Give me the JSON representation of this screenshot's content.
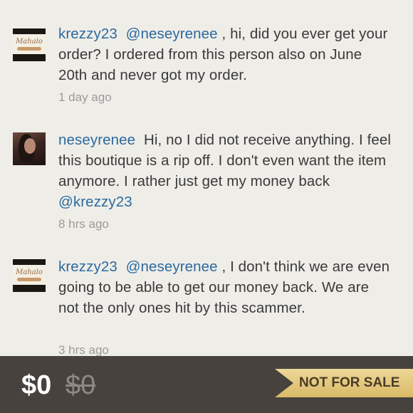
{
  "comments": [
    {
      "username": "krezzy23",
      "mention": "@neseyrenee",
      "text": ", hi, did you ever get your order? I ordered from this person also on June 20th and never got my order.",
      "time": "1 day ago",
      "avatar_text": "Mahalo"
    },
    {
      "username": "neseyrenee",
      "text": "Hi, no I did not receive anything. I feel this boutique is a rip off. I don't even want the item anymore. I rather just get my money back",
      "mention": "@krezzy23",
      "time": "8 hrs ago"
    },
    {
      "username": "krezzy23",
      "mention": "@neseyrenee",
      "text": ", I don't think we are even going to be able to get our money back. We are not the only ones hit by this scammer.",
      "time": "3 hrs ago",
      "avatar_text": "Mahalo"
    }
  ],
  "listing": {
    "price": "$0",
    "original_price": "$0",
    "status": "NOT FOR SALE"
  },
  "colors": {
    "link": "#2c6aa0",
    "text": "#3a3a3a",
    "timestamp": "#9b9b9b",
    "background": "#efede8",
    "bottom_bar": "#47423e",
    "ribbon": "#e4c77f"
  }
}
